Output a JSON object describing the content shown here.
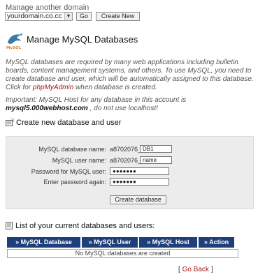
{
  "header": {
    "manage_link": "Manage another domain",
    "domain_selected": "yourdomain.co.cc",
    "go_label": "Go",
    "create_new_label": "Create New"
  },
  "page": {
    "title": "Manage MySQL Databases",
    "intro_part1": "MySQL databases are required by many web applications including bulletin boards, content management systems, and others. To use MySQL, you need to create database and user, which will be automatically assigned to this database. Click for ",
    "intro_link": "phpMyAdmin",
    "intro_part2": " when database is created.",
    "important_part1": "Important: MySQL Host for any database in this account is ",
    "important_host": "mysql5.000webhost.com",
    "important_part2": " , do not use localhost!"
  },
  "create_section": {
    "heading": "Create new database and user",
    "db_name_label": "MySQL database name:",
    "db_prefix": "a8702076_",
    "db_value": "DB1",
    "user_name_label": "MySQL user name:",
    "user_prefix": "a8702076_",
    "user_value": "name",
    "password_label": "Password for MySQL user:",
    "password_value": "●●●●●●●",
    "password_again_label": "Enter password again:",
    "password_again_value": "●●●●●●●",
    "create_button": "Create database"
  },
  "list_section": {
    "heading": "List of your current databases and users:",
    "columns": [
      "» MySQL Database",
      "» MySQL User",
      "» MySQL Host",
      "» Action"
    ],
    "empty_message": "No MySQL databases are created",
    "go_back": "Go Back"
  },
  "colors": {
    "table_header_bg": "#1f3f7a",
    "link_red": "#a01818",
    "form_bg": "#ececec"
  },
  "icons": [
    "mysql-dolphin-icon",
    "add-database-icon",
    "list-icon",
    "select-caret-icon"
  ]
}
